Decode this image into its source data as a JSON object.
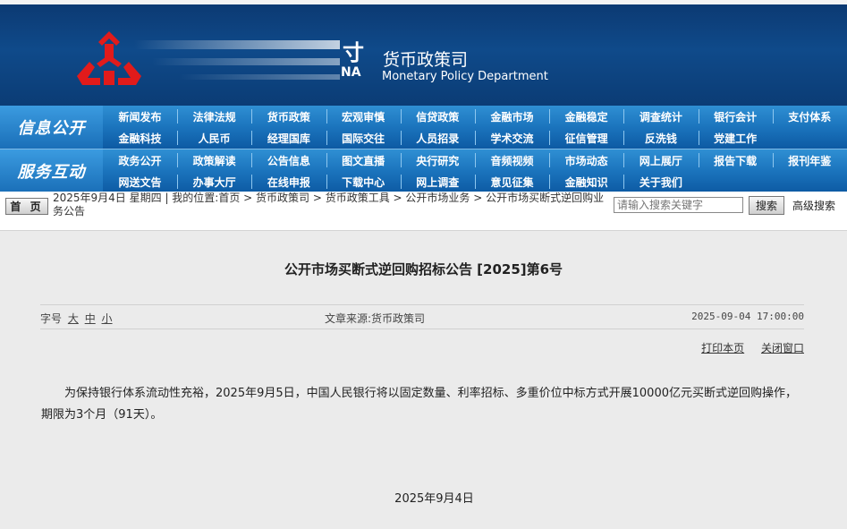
{
  "header": {
    "logo_text_fragment": "寸",
    "logo_text_fragment2": "NA",
    "dept_cn": "货币政策司",
    "dept_en": "Monetary Policy Department"
  },
  "nav": {
    "row1_title": "信息公开",
    "row2_title": "服务互动",
    "row1_items": [
      "新闻发布",
      "法律法规",
      "货币政策",
      "宏观审慎",
      "信贷政策",
      "金融市场",
      "金融稳定",
      "调查统计",
      "银行会计",
      "支付体系",
      "金融科技",
      "人民币",
      "经理国库",
      "国际交往",
      "人员招录",
      "学术交流",
      "征信管理",
      "反洗钱",
      "党建工作"
    ],
    "row2_items": [
      "政务公开",
      "政策解读",
      "公告信息",
      "图文直播",
      "央行研究",
      "音频视频",
      "市场动态",
      "网上展厅",
      "报告下载",
      "报刊年鉴",
      "网送文告",
      "办事大厅",
      "在线申报",
      "下载中心",
      "网上调查",
      "意见征集",
      "金融知识",
      "关于我们"
    ]
  },
  "crumb": {
    "home": "首 页",
    "text": "2025年9月4日 星期四 | 我的位置:首页 > 货币政策司 > 货币政策工具 > 公开市场业务 > 公开市场买断式逆回购业务公告",
    "search_placeholder": "请输入搜索关键字",
    "search_btn": "搜索",
    "adv_search": "高级搜索"
  },
  "article": {
    "title": "公开市场买断式逆回购招标公告 [2025]第6号",
    "font_label": "字号",
    "font_sizes": [
      "大",
      "中",
      "小"
    ],
    "source": "文章来源:货币政策司",
    "time": "2025-09-04 17:00:00",
    "print": "打印本页",
    "close": "关闭窗口",
    "body": "为保持银行体系流动性充裕，2025年9月5日，中国人民银行将以固定数量、利率招标、多重价位中标方式开展10000亿元买断式逆回购操作，期限为3个月（91天）。",
    "date": "2025年9月4日"
  },
  "colors": {
    "banner": "#0f4a8a",
    "nav": "#1b74bd",
    "logo_red": "#e11b1b"
  }
}
